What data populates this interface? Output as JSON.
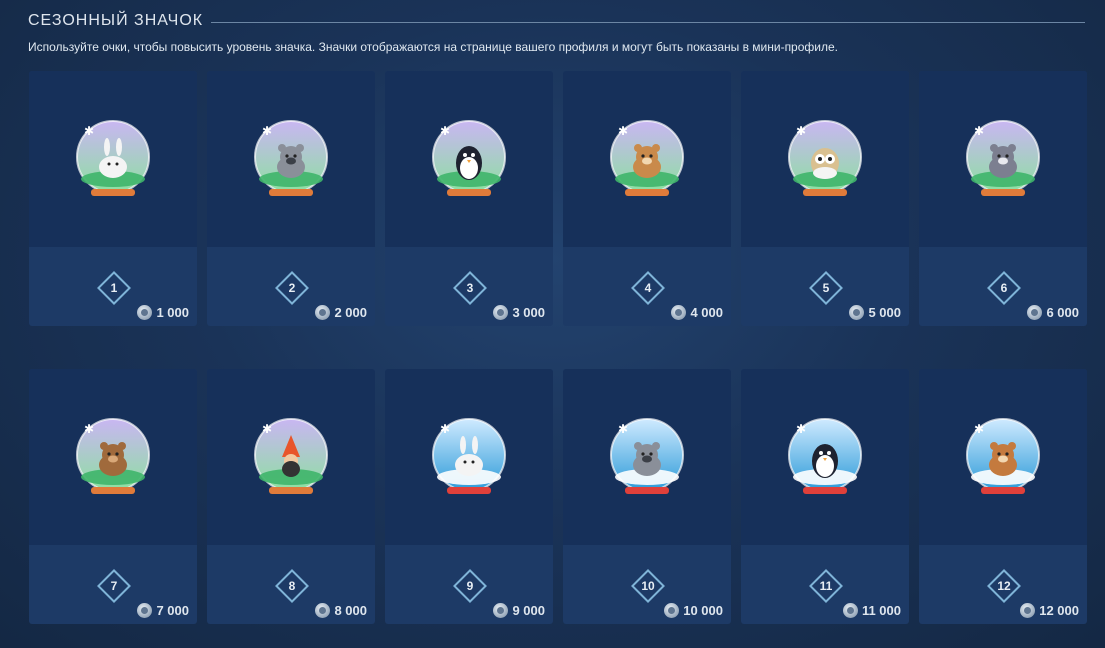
{
  "header": {
    "title": "СЕЗОННЫЙ ЗНАЧОК",
    "description": "Используйте очки, чтобы повысить уровень значка. Значки отображаются на странице вашего профиля и могут быть показаны в мини-профиле."
  },
  "badges": [
    {
      "level": "1",
      "cost": "1 000",
      "animal": "rabbit",
      "style": "purple"
    },
    {
      "level": "2",
      "cost": "2 000",
      "animal": "raccoon",
      "style": "purple"
    },
    {
      "level": "3",
      "cost": "3 000",
      "animal": "penguin",
      "style": "purple"
    },
    {
      "level": "4",
      "cost": "4 000",
      "animal": "fawn",
      "style": "purple"
    },
    {
      "level": "5",
      "cost": "5 000",
      "animal": "owl",
      "style": "purple"
    },
    {
      "level": "6",
      "cost": "6 000",
      "animal": "wolf",
      "style": "purple"
    },
    {
      "level": "7",
      "cost": "7 000",
      "animal": "bear",
      "style": "purple"
    },
    {
      "level": "8",
      "cost": "8 000",
      "animal": "gnome",
      "style": "purple"
    },
    {
      "level": "9",
      "cost": "9 000",
      "animal": "rabbit",
      "style": "blue"
    },
    {
      "level": "10",
      "cost": "10 000",
      "animal": "raccoon",
      "style": "blue"
    },
    {
      "level": "11",
      "cost": "11 000",
      "animal": "penguin",
      "style": "blue"
    },
    {
      "level": "12",
      "cost": "12 000",
      "animal": "deer",
      "style": "blue"
    }
  ],
  "colors": {
    "accent": "#7fb4d8",
    "card": "#1d3a66"
  }
}
